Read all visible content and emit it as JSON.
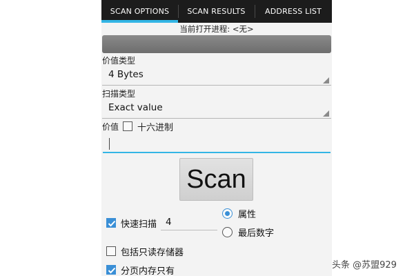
{
  "tabs": [
    {
      "label": "SCAN OPTIONS",
      "active": true
    },
    {
      "label": "SCAN RESULTS",
      "active": false
    },
    {
      "label": "ADDRESS LIST",
      "active": false
    }
  ],
  "process": {
    "label": "当前打开进程: <无>"
  },
  "value_type": {
    "label": "价值类型",
    "selected": "4 Bytes"
  },
  "scan_type": {
    "label": "扫描类型",
    "selected": "Exact value"
  },
  "value": {
    "label": "价值",
    "hex_label": "十六进制",
    "hex_checked": false,
    "input_value": ""
  },
  "scan_button": {
    "label": "Scan"
  },
  "fast_scan": {
    "label": "快速扫描",
    "checked": true,
    "value": "4"
  },
  "radio_options": [
    {
      "label": "属性",
      "selected": true
    },
    {
      "label": "最后数字",
      "selected": false
    }
  ],
  "readonly_memory": {
    "label": "包括只读存储器",
    "checked": false
  },
  "paged_memory": {
    "label": "分页内存只有",
    "checked": true
  },
  "watermark": {
    "text": "头条 @苏盟929"
  },
  "colors": {
    "accent": "#33b5e5",
    "checkbox": "#3a8fd6",
    "tabbar": "#1c1c1c"
  }
}
